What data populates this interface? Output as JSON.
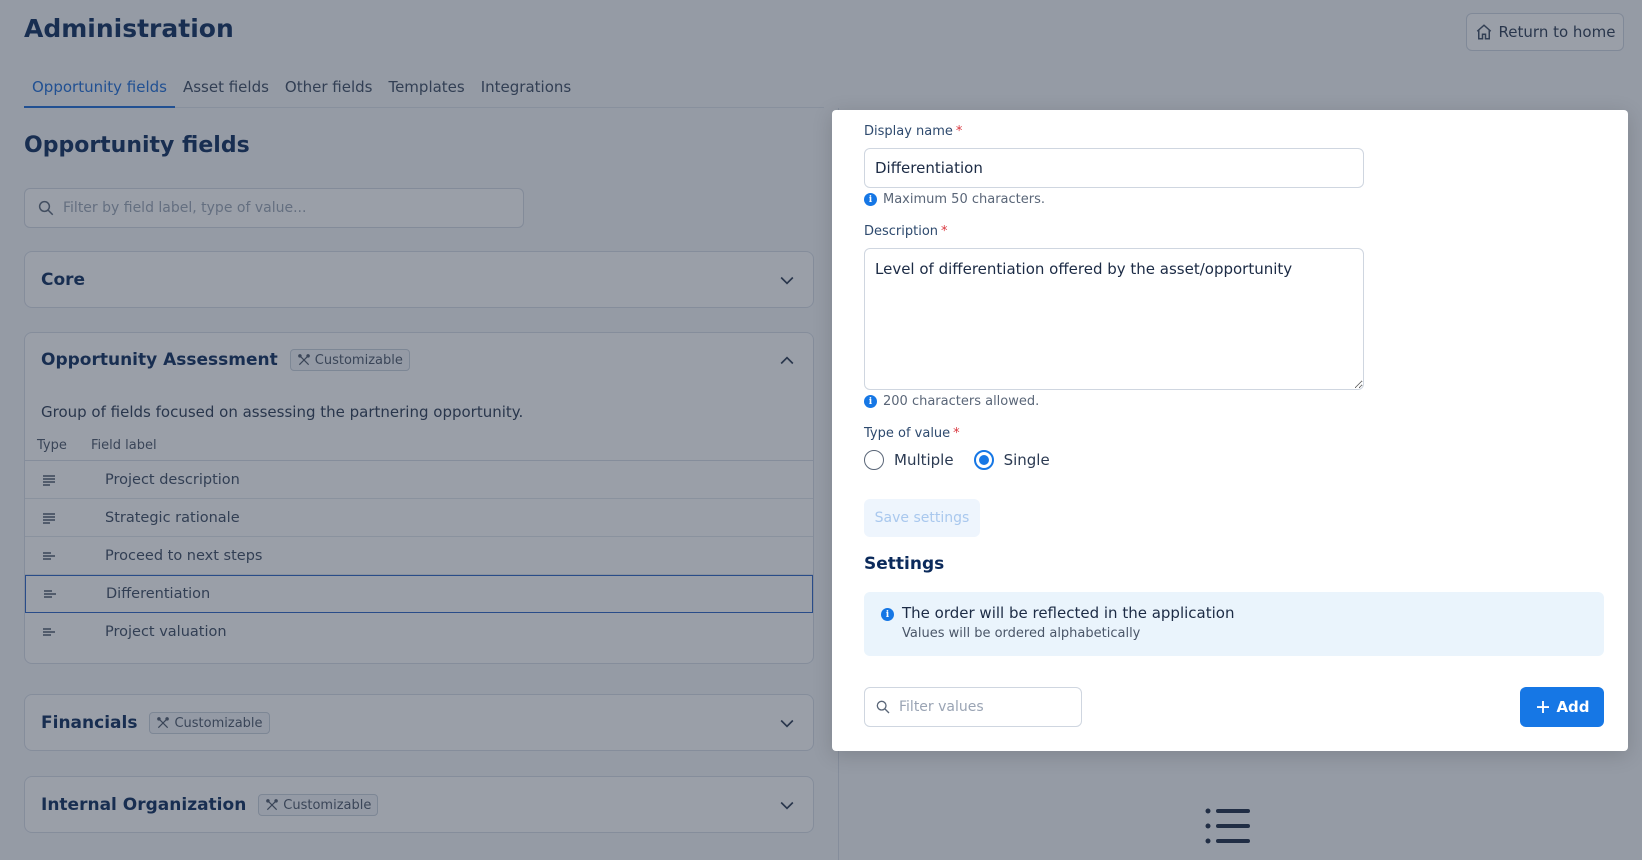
{
  "header": {
    "title": "Administration",
    "return_home_label": "Return to home"
  },
  "tabs": [
    {
      "label": "Opportunity fields",
      "active": true
    },
    {
      "label": "Asset fields"
    },
    {
      "label": "Other fields"
    },
    {
      "label": "Templates"
    },
    {
      "label": "Integrations"
    }
  ],
  "main": {
    "section_title": "Opportunity fields",
    "filter_placeholder": "Filter by field label, type of value..."
  },
  "groups": {
    "core": {
      "title": "Core"
    },
    "assessment": {
      "title": "Opportunity Assessment",
      "badge": "Customizable",
      "description": "Group of fields focused on assessing the partnering opportunity.",
      "col_type": "Type",
      "col_label": "Field label",
      "rows": [
        {
          "label": "Project description",
          "icon": "multi-line-text-icon"
        },
        {
          "label": "Strategic rationale",
          "icon": "multi-line-text-icon"
        },
        {
          "label": "Proceed to next steps",
          "icon": "single-select-icon"
        },
        {
          "label": "Differentiation",
          "icon": "single-select-icon",
          "selected": true
        },
        {
          "label": "Project valuation",
          "icon": "single-select-icon"
        }
      ]
    },
    "financials": {
      "title": "Financials",
      "badge": "Customizable"
    },
    "internal": {
      "title": "Internal Organization",
      "badge": "Customizable"
    }
  },
  "modal": {
    "display_name_label": "Display name",
    "display_name_value": "Differentiation",
    "display_name_hint": "Maximum 50 characters.",
    "description_label": "Description",
    "description_value": "Level of differentiation offered by the asset/opportunity",
    "description_hint": "200 characters allowed.",
    "type_label": "Type of value",
    "type_multiple": "Multiple",
    "type_single": "Single",
    "save_label": "Save settings",
    "settings_title": "Settings",
    "info_title": "The order will be reflected in the application",
    "info_sub": "Values will be ordered alphabetically",
    "filter_values_placeholder": "Filter values",
    "add_label": "Add",
    "required_mark": "*"
  },
  "colors": {
    "primary": "#1677e5",
    "heading": "#0b2a5b",
    "required": "#d9363e"
  }
}
